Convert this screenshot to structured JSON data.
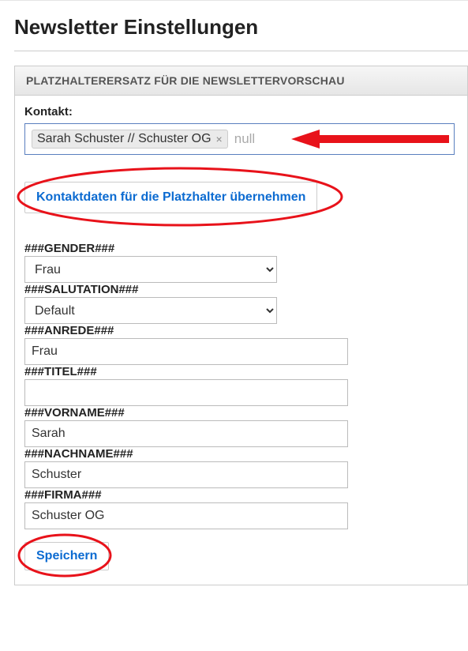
{
  "page": {
    "title": "Newsletter Einstellungen"
  },
  "panel": {
    "header": "PLATZHALTERERSATZ FÜR DIE NEWSLETTERVORSCHAU",
    "contact_label": "Kontakt:",
    "contact_chip": "Sarah Schuster // Schuster OG",
    "null_text": "null",
    "apply_button": "Kontaktdaten für die Platzhalter übernehmen",
    "fields": {
      "gender": {
        "label": "###GENDER###",
        "value": "Frau"
      },
      "salutation": {
        "label": "###SALUTATION###",
        "value": "Default"
      },
      "anrede": {
        "label": "###ANREDE###",
        "value": "Frau"
      },
      "titel": {
        "label": "###TITEL###",
        "value": ""
      },
      "vorname": {
        "label": "###VORNAME###",
        "value": "Sarah"
      },
      "nachname": {
        "label": "###NACHNAME###",
        "value": "Schuster"
      },
      "firma": {
        "label": "###FIRMA###",
        "value": "Schuster OG"
      }
    },
    "save_button": "Speichern"
  },
  "annotations": {
    "arrow_color": "#e8121a",
    "ellipse_color": "#e8121a"
  }
}
